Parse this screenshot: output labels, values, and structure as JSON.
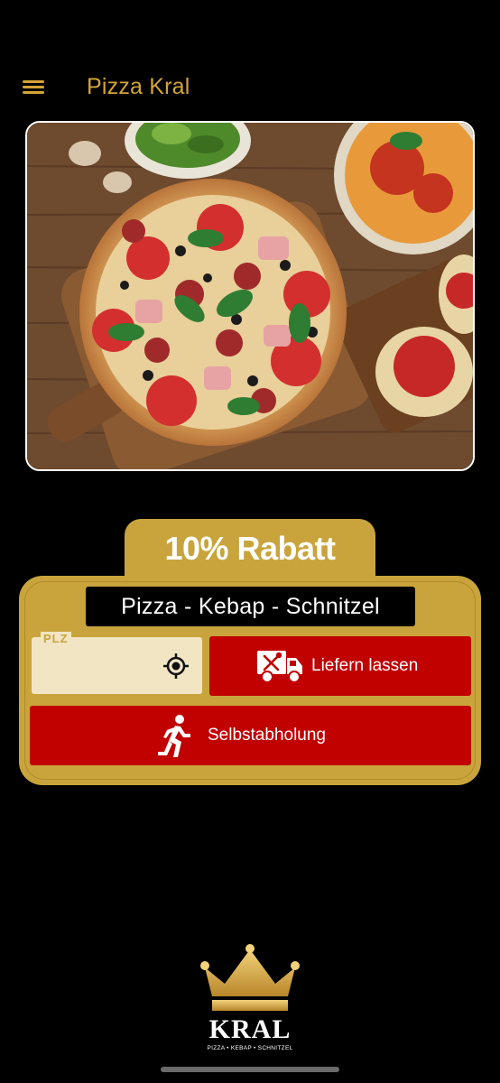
{
  "header": {
    "title": "Pizza Kral",
    "menu_icon": "hamburger-menu-icon"
  },
  "hero": {
    "image_desc": "food-photo-pizza-pasta-bruschetta"
  },
  "promo": {
    "badge": "10% Rabatt"
  },
  "order_card": {
    "tagline": "Pizza - Kebap - Schnitzel",
    "plz_field": {
      "label": "PLZ",
      "value": "",
      "icon": "gps-locate-icon"
    },
    "deliver_button": {
      "label": "Liefern lassen",
      "icon": "delivery-truck-icon"
    },
    "pickup_button": {
      "label": "Selbstabholung",
      "icon": "walking-person-icon"
    }
  },
  "footer_logo": {
    "word": "KRAL",
    "subtitle": "PIZZA • KEBAP • SCHNITZEL",
    "icon": "crown-icon"
  },
  "colors": {
    "background": "#000000",
    "gold": "#c9a43c",
    "title_gold": "#d4a536",
    "red": "#c10000",
    "field_bg": "#f1e5c4"
  }
}
